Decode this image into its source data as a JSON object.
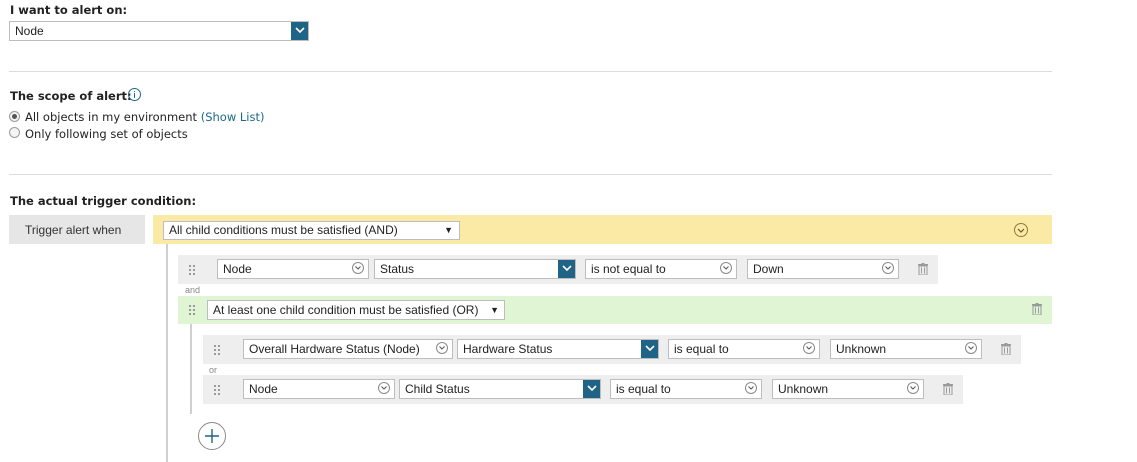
{
  "alert_on": {
    "label": "I want to alert on:",
    "value": "Node"
  },
  "scope": {
    "label": "The scope of alert:",
    "info_icon": "info-icon",
    "option_all": "All objects in my environment",
    "show_list_link": "(Show List)",
    "option_following": "Only following set of objects",
    "selected": "all"
  },
  "trigger": {
    "label": "The actual trigger condition:",
    "trigger_when": "Trigger alert when",
    "root_condition": "All child conditions must be satisfied (AND)",
    "row1": {
      "object": "Node",
      "field": "Status",
      "operator": "is not equal to",
      "value": "Down"
    },
    "connector_and": "and",
    "group": {
      "condition": "At least one child condition must be satisfied (OR)",
      "row1": {
        "object": "Overall Hardware Status (Node)",
        "field": "Hardware Status",
        "operator": "is equal to",
        "value": "Unknown"
      },
      "connector_or": "or",
      "row2": {
        "object": "Node",
        "field": "Child Status",
        "operator": "is equal to",
        "value": "Unknown"
      }
    },
    "add_icon": "plus-circle-icon"
  },
  "colors": {
    "and_group": "#fbe9a6",
    "or_group": "#dff5d3",
    "accent": "#1f6386",
    "link": "#1a6a8a"
  }
}
